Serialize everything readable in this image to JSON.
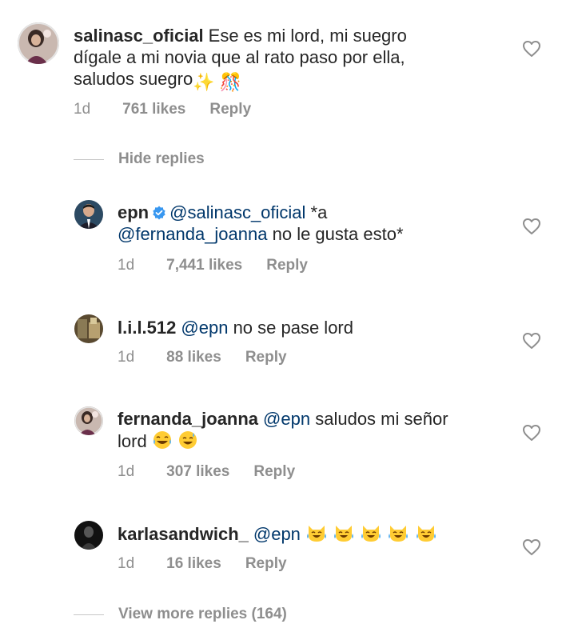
{
  "comments": [
    {
      "username": "salinasc_oficial",
      "text_line1": "Ese es mi lord, mi suegro",
      "text_line2": "dígale a mi novia que al rato paso por ella,",
      "text_line3": "saludos suegro",
      "emoji": "✨ 🎊",
      "time": "1d",
      "likes": "761 likes",
      "reply": "Reply"
    },
    {
      "username": "epn",
      "mention1": "@salinasc_oficial",
      "text_after1": "*a",
      "mention2": "@fernanda_joanna",
      "text_after2": "no le gusta esto*",
      "time": "1d",
      "likes": "7,441 likes",
      "reply": "Reply"
    },
    {
      "username": "l.i.l.512",
      "mention": "@epn",
      "text": "no se pase lord",
      "time": "1d",
      "likes": "88 likes",
      "reply": "Reply"
    },
    {
      "username": "fernanda_joanna",
      "mention": "@epn",
      "text_line1": "saludos mi señor",
      "text_line2": "lord",
      "time": "1d",
      "likes": "307 likes",
      "reply": "Reply"
    },
    {
      "username": "karlasandwich_",
      "mention": "@epn",
      "time": "1d",
      "likes": "16 likes",
      "reply": "Reply"
    }
  ],
  "hide_replies": "Hide replies",
  "view_more_replies": "View more replies (164)",
  "colors": {
    "text": "#262626",
    "secondary": "#8e8e8e",
    "mention": "#00376b",
    "verified": "#3897f0"
  },
  "icons": [
    "heart-outline-icon",
    "verified-badge-icon",
    "sparkles-emoji",
    "confetti-emoji",
    "tears-of-joy-emoji",
    "sweat-smile-emoji",
    "crying-laughing-cat-emoji"
  ]
}
